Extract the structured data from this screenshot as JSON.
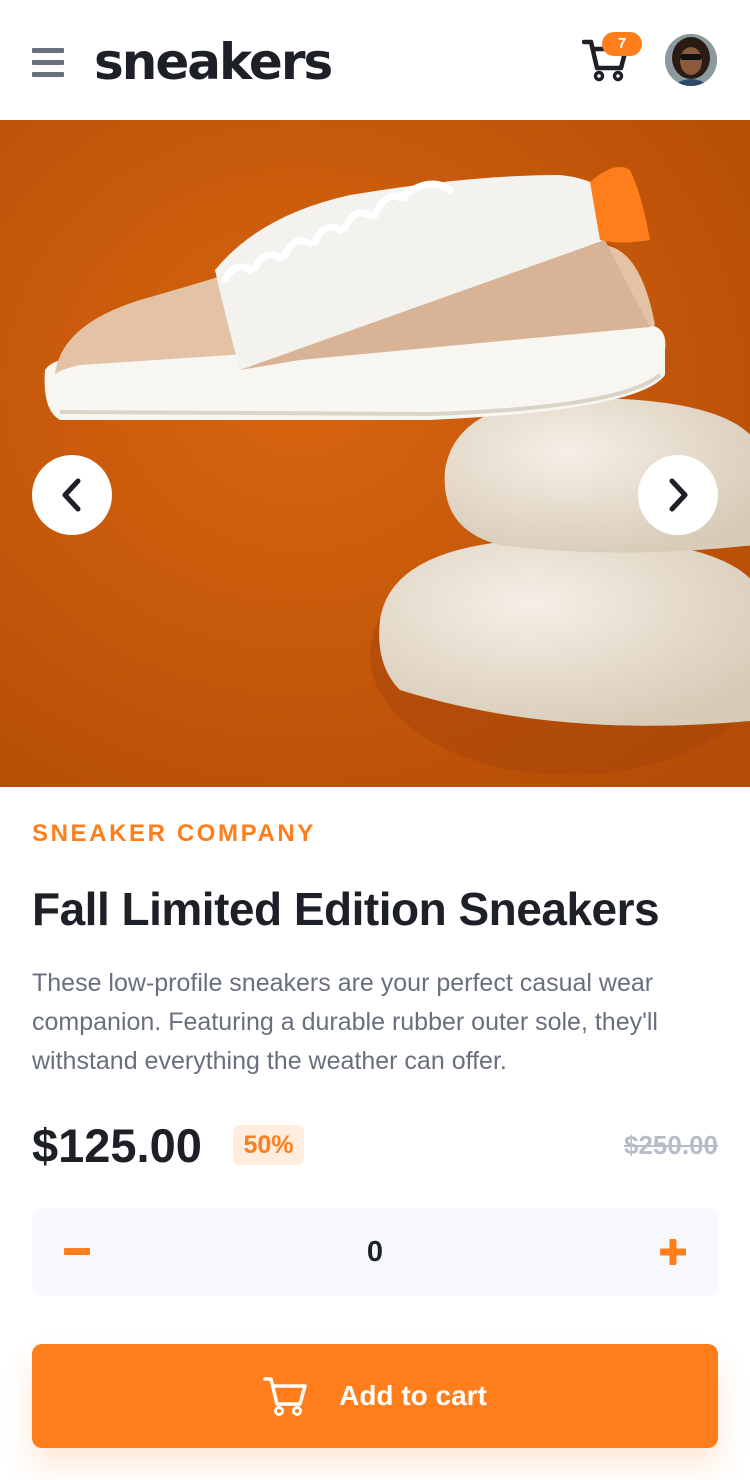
{
  "header": {
    "logo": "sneakers",
    "cart_count": "7"
  },
  "product": {
    "company": "SNEAKER COMPANY",
    "title": "Fall Limited Edition Sneakers",
    "description": "These low-profile sneakers are your perfect casual wear companion. Featuring a durable rubber outer sole, they'll withstand everything the weather can offer.",
    "price": "$125.00",
    "discount": "50%",
    "original_price": "$250.00"
  },
  "quantity": {
    "value": "0"
  },
  "add_to_cart": {
    "label": "Add to cart"
  },
  "colors": {
    "accent": "#ff7e1b",
    "accent_pale": "#ffede0",
    "text_dark": "#1d2026",
    "text_gray": "#69707d",
    "text_light": "#b6bcc8",
    "surface": "#f6f8fd",
    "hero_bg": "#c95a0a"
  },
  "icons": {
    "menu": "menu-icon",
    "cart": "cart-icon",
    "prev": "chevron-left-icon",
    "next": "chevron-right-icon",
    "minus": "minus-icon",
    "plus": "plus-icon"
  }
}
